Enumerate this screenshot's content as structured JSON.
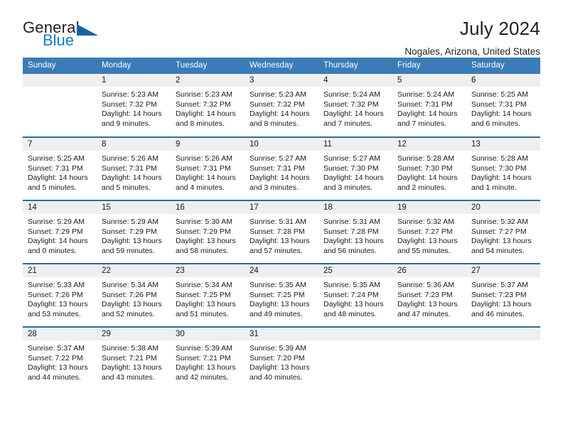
{
  "brand": {
    "name_part1": "General",
    "name_part2": "Blue",
    "triangle_icon": "triangle-icon",
    "accent_color": "#1464a5"
  },
  "header": {
    "title": "July 2024",
    "subtitle": "Nogales, Arizona, United States"
  },
  "calendar": {
    "header_bg": "#3b7cb8",
    "row_divider": "#2a6ca8",
    "daynum_band_bg": "#efefef",
    "weekday_headers": [
      "Sunday",
      "Monday",
      "Tuesday",
      "Wednesday",
      "Thursday",
      "Friday",
      "Saturday"
    ],
    "weeks": [
      [
        {
          "day": "",
          "empty": true
        },
        {
          "day": "1",
          "sunrise": "Sunrise: 5:23 AM",
          "sunset": "Sunset: 7:32 PM",
          "daylight1": "Daylight: 14 hours",
          "daylight2": "and 9 minutes."
        },
        {
          "day": "2",
          "sunrise": "Sunrise: 5:23 AM",
          "sunset": "Sunset: 7:32 PM",
          "daylight1": "Daylight: 14 hours",
          "daylight2": "and 8 minutes."
        },
        {
          "day": "3",
          "sunrise": "Sunrise: 5:23 AM",
          "sunset": "Sunset: 7:32 PM",
          "daylight1": "Daylight: 14 hours",
          "daylight2": "and 8 minutes."
        },
        {
          "day": "4",
          "sunrise": "Sunrise: 5:24 AM",
          "sunset": "Sunset: 7:32 PM",
          "daylight1": "Daylight: 14 hours",
          "daylight2": "and 7 minutes."
        },
        {
          "day": "5",
          "sunrise": "Sunrise: 5:24 AM",
          "sunset": "Sunset: 7:31 PM",
          "daylight1": "Daylight: 14 hours",
          "daylight2": "and 7 minutes."
        },
        {
          "day": "6",
          "sunrise": "Sunrise: 5:25 AM",
          "sunset": "Sunset: 7:31 PM",
          "daylight1": "Daylight: 14 hours",
          "daylight2": "and 6 minutes."
        }
      ],
      [
        {
          "day": "7",
          "sunrise": "Sunrise: 5:25 AM",
          "sunset": "Sunset: 7:31 PM",
          "daylight1": "Daylight: 14 hours",
          "daylight2": "and 5 minutes."
        },
        {
          "day": "8",
          "sunrise": "Sunrise: 5:26 AM",
          "sunset": "Sunset: 7:31 PM",
          "daylight1": "Daylight: 14 hours",
          "daylight2": "and 5 minutes."
        },
        {
          "day": "9",
          "sunrise": "Sunrise: 5:26 AM",
          "sunset": "Sunset: 7:31 PM",
          "daylight1": "Daylight: 14 hours",
          "daylight2": "and 4 minutes."
        },
        {
          "day": "10",
          "sunrise": "Sunrise: 5:27 AM",
          "sunset": "Sunset: 7:31 PM",
          "daylight1": "Daylight: 14 hours",
          "daylight2": "and 3 minutes."
        },
        {
          "day": "11",
          "sunrise": "Sunrise: 5:27 AM",
          "sunset": "Sunset: 7:30 PM",
          "daylight1": "Daylight: 14 hours",
          "daylight2": "and 3 minutes."
        },
        {
          "day": "12",
          "sunrise": "Sunrise: 5:28 AM",
          "sunset": "Sunset: 7:30 PM",
          "daylight1": "Daylight: 14 hours",
          "daylight2": "and 2 minutes."
        },
        {
          "day": "13",
          "sunrise": "Sunrise: 5:28 AM",
          "sunset": "Sunset: 7:30 PM",
          "daylight1": "Daylight: 14 hours",
          "daylight2": "and 1 minute."
        }
      ],
      [
        {
          "day": "14",
          "sunrise": "Sunrise: 5:29 AM",
          "sunset": "Sunset: 7:29 PM",
          "daylight1": "Daylight: 14 hours",
          "daylight2": "and 0 minutes."
        },
        {
          "day": "15",
          "sunrise": "Sunrise: 5:29 AM",
          "sunset": "Sunset: 7:29 PM",
          "daylight1": "Daylight: 13 hours",
          "daylight2": "and 59 minutes."
        },
        {
          "day": "16",
          "sunrise": "Sunrise: 5:30 AM",
          "sunset": "Sunset: 7:29 PM",
          "daylight1": "Daylight: 13 hours",
          "daylight2": "and 58 minutes."
        },
        {
          "day": "17",
          "sunrise": "Sunrise: 5:31 AM",
          "sunset": "Sunset: 7:28 PM",
          "daylight1": "Daylight: 13 hours",
          "daylight2": "and 57 minutes."
        },
        {
          "day": "18",
          "sunrise": "Sunrise: 5:31 AM",
          "sunset": "Sunset: 7:28 PM",
          "daylight1": "Daylight: 13 hours",
          "daylight2": "and 56 minutes."
        },
        {
          "day": "19",
          "sunrise": "Sunrise: 5:32 AM",
          "sunset": "Sunset: 7:27 PM",
          "daylight1": "Daylight: 13 hours",
          "daylight2": "and 55 minutes."
        },
        {
          "day": "20",
          "sunrise": "Sunrise: 5:32 AM",
          "sunset": "Sunset: 7:27 PM",
          "daylight1": "Daylight: 13 hours",
          "daylight2": "and 54 minutes."
        }
      ],
      [
        {
          "day": "21",
          "sunrise": "Sunrise: 5:33 AM",
          "sunset": "Sunset: 7:26 PM",
          "daylight1": "Daylight: 13 hours",
          "daylight2": "and 53 minutes."
        },
        {
          "day": "22",
          "sunrise": "Sunrise: 5:34 AM",
          "sunset": "Sunset: 7:26 PM",
          "daylight1": "Daylight: 13 hours",
          "daylight2": "and 52 minutes."
        },
        {
          "day": "23",
          "sunrise": "Sunrise: 5:34 AM",
          "sunset": "Sunset: 7:25 PM",
          "daylight1": "Daylight: 13 hours",
          "daylight2": "and 51 minutes."
        },
        {
          "day": "24",
          "sunrise": "Sunrise: 5:35 AM",
          "sunset": "Sunset: 7:25 PM",
          "daylight1": "Daylight: 13 hours",
          "daylight2": "and 49 minutes."
        },
        {
          "day": "25",
          "sunrise": "Sunrise: 5:35 AM",
          "sunset": "Sunset: 7:24 PM",
          "daylight1": "Daylight: 13 hours",
          "daylight2": "and 48 minutes."
        },
        {
          "day": "26",
          "sunrise": "Sunrise: 5:36 AM",
          "sunset": "Sunset: 7:23 PM",
          "daylight1": "Daylight: 13 hours",
          "daylight2": "and 47 minutes."
        },
        {
          "day": "27",
          "sunrise": "Sunrise: 5:37 AM",
          "sunset": "Sunset: 7:23 PM",
          "daylight1": "Daylight: 13 hours",
          "daylight2": "and 46 minutes."
        }
      ],
      [
        {
          "day": "28",
          "sunrise": "Sunrise: 5:37 AM",
          "sunset": "Sunset: 7:22 PM",
          "daylight1": "Daylight: 13 hours",
          "daylight2": "and 44 minutes."
        },
        {
          "day": "29",
          "sunrise": "Sunrise: 5:38 AM",
          "sunset": "Sunset: 7:21 PM",
          "daylight1": "Daylight: 13 hours",
          "daylight2": "and 43 minutes."
        },
        {
          "day": "30",
          "sunrise": "Sunrise: 5:39 AM",
          "sunset": "Sunset: 7:21 PM",
          "daylight1": "Daylight: 13 hours",
          "daylight2": "and 42 minutes."
        },
        {
          "day": "31",
          "sunrise": "Sunrise: 5:39 AM",
          "sunset": "Sunset: 7:20 PM",
          "daylight1": "Daylight: 13 hours",
          "daylight2": "and 40 minutes."
        },
        {
          "day": "",
          "empty": true
        },
        {
          "day": "",
          "empty": true
        },
        {
          "day": "",
          "empty": true
        }
      ]
    ]
  }
}
